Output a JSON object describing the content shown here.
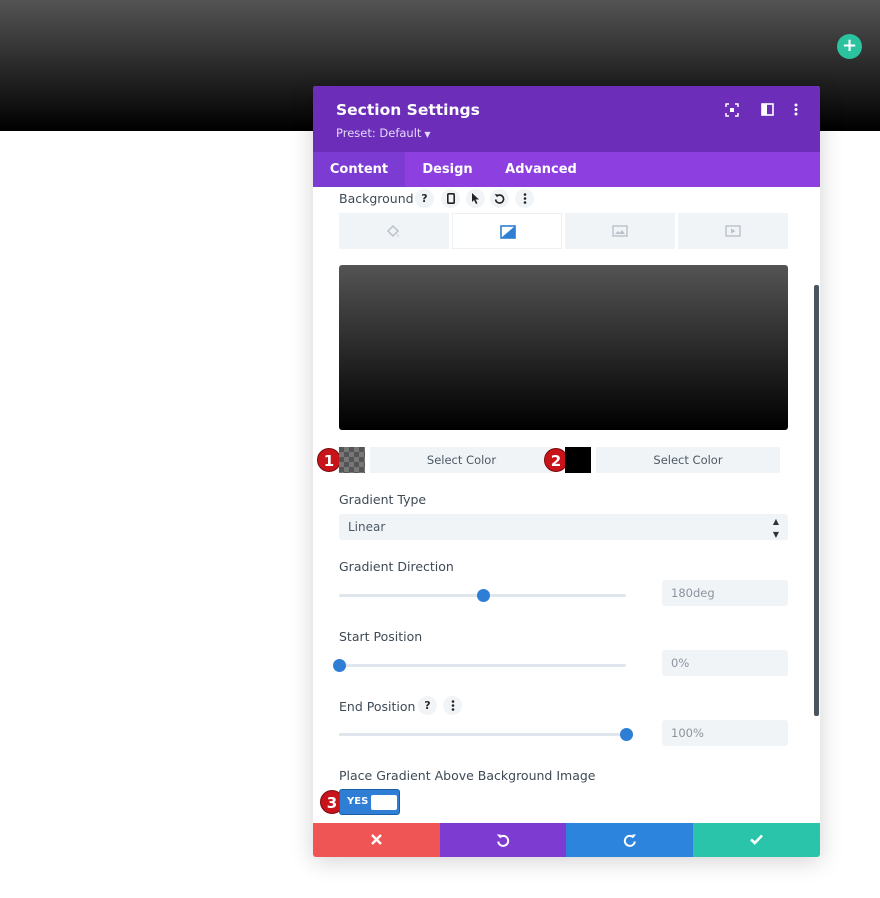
{
  "page": {
    "add_icon": "plus-icon",
    "add_color": "#2bc2a0",
    "hero_gradient": [
      "#545454",
      "#000000"
    ]
  },
  "modal": {
    "title": "Section Settings",
    "preset": "Preset: Default",
    "header_color": "#6c2eb9",
    "header_icons": [
      "fullscreen-icon",
      "split-view-icon",
      "more-options-icon"
    ]
  },
  "tabs": [
    {
      "label": "Content",
      "active": true
    },
    {
      "label": "Design",
      "active": false
    },
    {
      "label": "Advanced",
      "active": false
    }
  ],
  "background": {
    "label": "Background",
    "tool_icons": [
      "help-icon",
      "mobile-icon",
      "hover-cursor-icon",
      "reset-icon",
      "more-options-icon"
    ],
    "type_tabs": [
      {
        "icon": "paint-bucket-icon",
        "active": false
      },
      {
        "icon": "gradient-icon",
        "active": true
      },
      {
        "icon": "image-icon",
        "active": false
      },
      {
        "icon": "video-icon",
        "active": false
      }
    ],
    "preview_gradient": [
      "#545454",
      "#000000"
    ]
  },
  "colors": {
    "stop1": {
      "label": "Select Color",
      "badge": "1",
      "color": "transparent-checker"
    },
    "stop2": {
      "label": "Select Color",
      "badge": "2",
      "color": "#000000"
    }
  },
  "gradient_type": {
    "label": "Gradient Type",
    "value": "Linear"
  },
  "gradient_direction": {
    "label": "Gradient Direction",
    "value": "180deg",
    "slider_fraction": 0.5
  },
  "start_position": {
    "label": "Start Position",
    "value": "0%",
    "slider_fraction": 0.0
  },
  "end_position": {
    "label": "End Position",
    "value": "100%",
    "slider_fraction": 1.0
  },
  "place_above": {
    "label": "Place Gradient Above Background Image",
    "toggle_text": "YES",
    "badge": "3",
    "on": true
  },
  "footer": {
    "buttons": [
      {
        "icon": "close-icon",
        "color": "#ef5555"
      },
      {
        "icon": "undo-icon",
        "color": "#7d3bd1"
      },
      {
        "icon": "redo-icon",
        "color": "#2c84dc"
      },
      {
        "icon": "check-icon",
        "color": "#29c4a9"
      }
    ]
  }
}
